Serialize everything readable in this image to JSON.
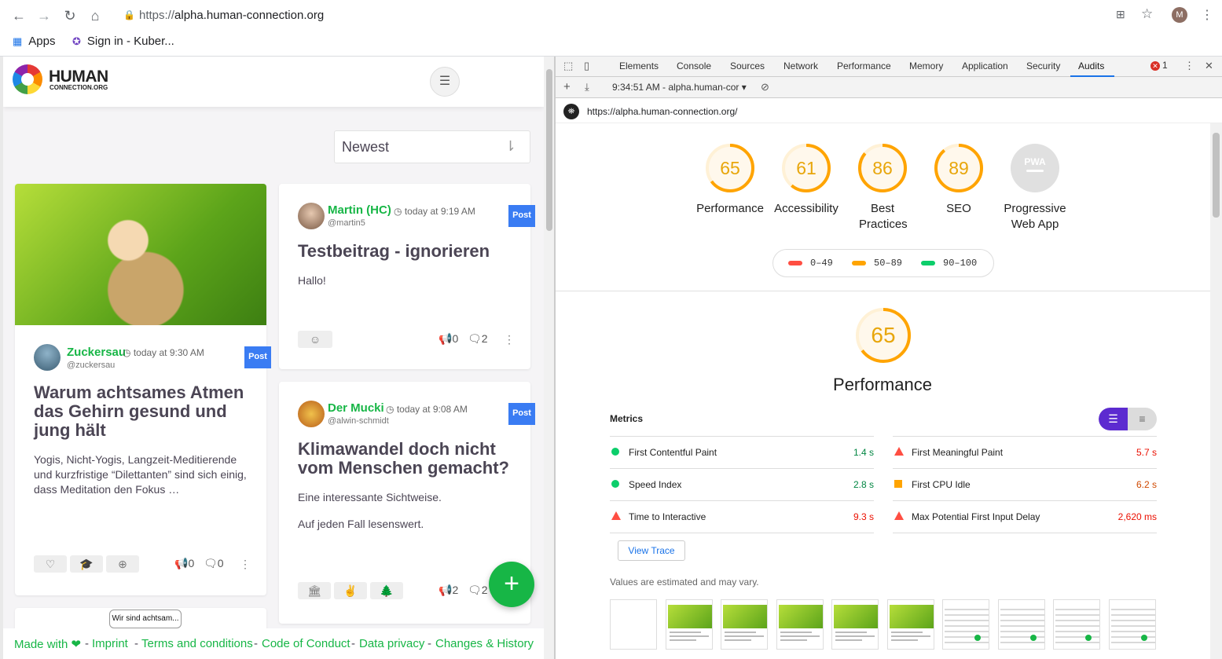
{
  "browser": {
    "url_scheme": "https://",
    "url_host": "alpha.human-connection.org",
    "profile_initial": "M",
    "bookmarks": [
      {
        "label": "Apps",
        "icon": "apps-grid-icon"
      },
      {
        "label": "Sign in - Kuber...",
        "icon": "kubernetes-icon"
      }
    ]
  },
  "site": {
    "logo_title": "HUMAN",
    "logo_sub": "CONNECTION.ORG",
    "sort_label": "Newest",
    "posts": [
      {
        "author": "Zuckersau",
        "time": "today at 9:30 AM",
        "handle": "@zuckersau",
        "badge": "Post",
        "title": "Warum achtsames Atmen das Gehirn gesund und jung hält",
        "body": "Yogis, Nicht-Yogis, Langzeit-Meditierende und kurzfristige “Dilettanten” sind sich einig, dass Meditation den Fokus …",
        "shouts": "0",
        "comments": "0"
      },
      {
        "author": "Martin (HC)",
        "time": "today at 9:19 AM",
        "handle": "@martin5",
        "badge": "Post",
        "title": "Testbeitrag - ignorieren",
        "body": "Hallo!",
        "shouts": "0",
        "comments": "2"
      },
      {
        "author": "Der Mucki",
        "time": "today at 9:08 AM",
        "handle": "@alwin-schmidt",
        "badge": "Post",
        "title": "Klimawandel doch nicht vom Menschen gemacht?",
        "body1": "Eine interessante Sichtweise.",
        "body2": "Auf jeden Fall lesenswert.",
        "shouts": "2",
        "comments": "2"
      }
    ],
    "card4_img_text": "Wir sind achtsam...",
    "footer": {
      "made_with": "Made with ❤",
      "imprint": "Imprint",
      "terms": "Terms and conditions",
      "coc": "Code of Conduct",
      "privacy": "Data privacy",
      "changes": "Changes & History",
      "sep": "-"
    }
  },
  "devtools": {
    "tabs": [
      "Elements",
      "Console",
      "Sources",
      "Network",
      "Performance",
      "Memory",
      "Application",
      "Security",
      "Audits"
    ],
    "active_tab": "Audits",
    "error_count": "1",
    "report_selector": "9:34:51 AM - alpha.human-cor ▾",
    "audited_url": "https://alpha.human-connection.org/",
    "categories": [
      {
        "score": "65",
        "label": "Performance",
        "pct": 65
      },
      {
        "score": "61",
        "label": "Accessibility",
        "pct": 61
      },
      {
        "score": "86",
        "label": "Best Practices",
        "pct": 86
      },
      {
        "score": "89",
        "label": "SEO",
        "pct": 89
      },
      {
        "score": "",
        "label": "Progressive Web App",
        "pct": 0
      }
    ],
    "pwa_badge": "PWA",
    "legend": [
      {
        "range": "0–49",
        "color": "#ff4e42"
      },
      {
        "range": "50–89",
        "color": "#ffa400"
      },
      {
        "range": "90–100",
        "color": "#0cce6b"
      }
    ],
    "perf_score": "65",
    "perf_title": "Performance",
    "metrics_header": "Metrics",
    "metrics": [
      {
        "label": "First Contentful Paint",
        "value": "1.4 s",
        "status": "pass"
      },
      {
        "label": "First Meaningful Paint",
        "value": "5.7 s",
        "status": "fail"
      },
      {
        "label": "Speed Index",
        "value": "2.8 s",
        "status": "pass"
      },
      {
        "label": "First CPU Idle",
        "value": "6.2 s",
        "status": "avg"
      },
      {
        "label": "Time to Interactive",
        "value": "9.3 s",
        "status": "fail"
      },
      {
        "label": "Max Potential First Input Delay",
        "value": "2,620 ms",
        "status": "fail"
      }
    ],
    "view_trace": "View Trace",
    "estimate_note": "Values are estimated and may vary.",
    "colors": {
      "average": "#ffa400",
      "pass": "#0cce6b",
      "fail": "#ff4e42"
    }
  }
}
